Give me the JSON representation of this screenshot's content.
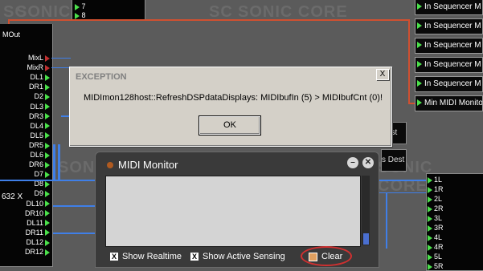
{
  "watermarks": [
    "SC",
    "SONIC CORE",
    "SC",
    "SONIC CORE",
    "SONIC",
    "SONIC CORE"
  ],
  "top_module": {
    "items": [
      "7",
      "8"
    ]
  },
  "mout_label": "MOut",
  "left_ports": [
    "MixL",
    "MixR",
    "DL1",
    "DR1",
    "D2",
    "DL3",
    "DR3",
    "DL4",
    "DL5",
    "DR5",
    "DL6",
    "DR6",
    "D7",
    "D8",
    "D9",
    "DL10",
    "DR10",
    "DL11",
    "DR11",
    "DL12",
    "DR12"
  ],
  "left_side_label": "632 X",
  "sequencer_items": [
    "In Sequencer M",
    "In Sequencer M",
    "In Sequencer M",
    "In Sequencer M",
    "In Sequencer M",
    "Min MIDI Monitor"
  ],
  "right_ports": [
    "1L",
    "1R",
    "2L",
    "2R",
    "3L",
    "3R",
    "4L",
    "4R",
    "5L",
    "5R"
  ],
  "dest_labels": [
    "est",
    "s Dest"
  ],
  "dest_tail": "Dest",
  "exception": {
    "title": "EXCEPTION",
    "close": "X",
    "message": "MIDImon128host::RefreshDSPdataDisplays: MIDIbufIn (5) > MIDIbufCnt (0)!",
    "ok": "OK"
  },
  "midi_monitor": {
    "title": "MIDI Monitor",
    "minimize": "–",
    "close": "✕",
    "show_realtime": "Show Realtime",
    "show_active_sensing": "Show Active Sensing",
    "check": "X",
    "clear": "Clear"
  },
  "colors": {
    "wire_blue": "#3f7fe8",
    "wire_red": "#d05030",
    "port_green": "#4be04b"
  }
}
